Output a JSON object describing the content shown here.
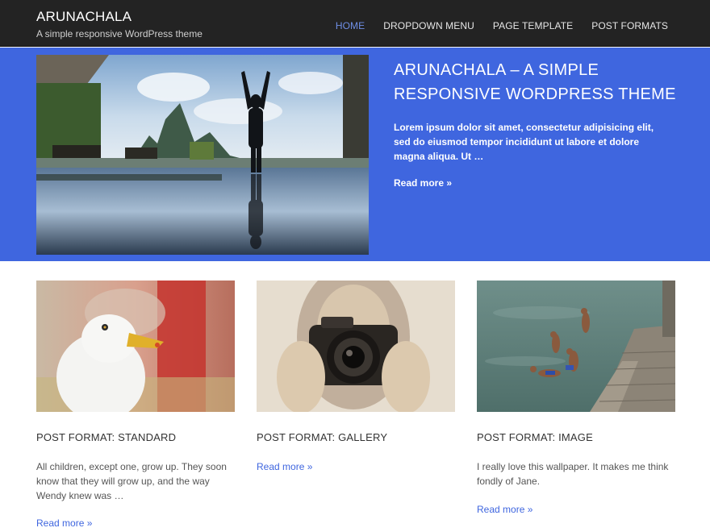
{
  "site": {
    "title": "ARUNACHALA",
    "description": "A simple responsive WordPress theme"
  },
  "nav": [
    {
      "label": "HOME",
      "active": true
    },
    {
      "label": "DROPDOWN MENU",
      "active": false
    },
    {
      "label": "PAGE TEMPLATE",
      "active": false
    },
    {
      "label": "POST FORMATS",
      "active": false
    }
  ],
  "hero": {
    "title": "ARUNACHALA – A SIMPLE RESPONSIVE WORDPRESS THEME",
    "excerpt": "Lorem ipsum dolor sit amet, consectetur adipisicing elit, sed do eiusmod tempor incididunt ut labore et dolore magna aliqua. Ut …",
    "read_more": "Read more »",
    "background_color": "#3f66df"
  },
  "posts": [
    {
      "title": "POST FORMAT: STANDARD",
      "excerpt": "All children, except one, grow up. They soon know that they will grow up, and the way Wendy knew was …",
      "read_more": "Read more »"
    },
    {
      "title": "POST FORMAT: GALLERY",
      "excerpt": "",
      "read_more": "Read more »"
    },
    {
      "title": "POST FORMAT: IMAGE",
      "excerpt": "I really love this wallpaper. It makes me think fondly of Jane.",
      "read_more": "Read more »"
    }
  ],
  "colors": {
    "header_bg": "#232323",
    "accent": "#3f66df",
    "nav_active": "#6f8fe6"
  }
}
